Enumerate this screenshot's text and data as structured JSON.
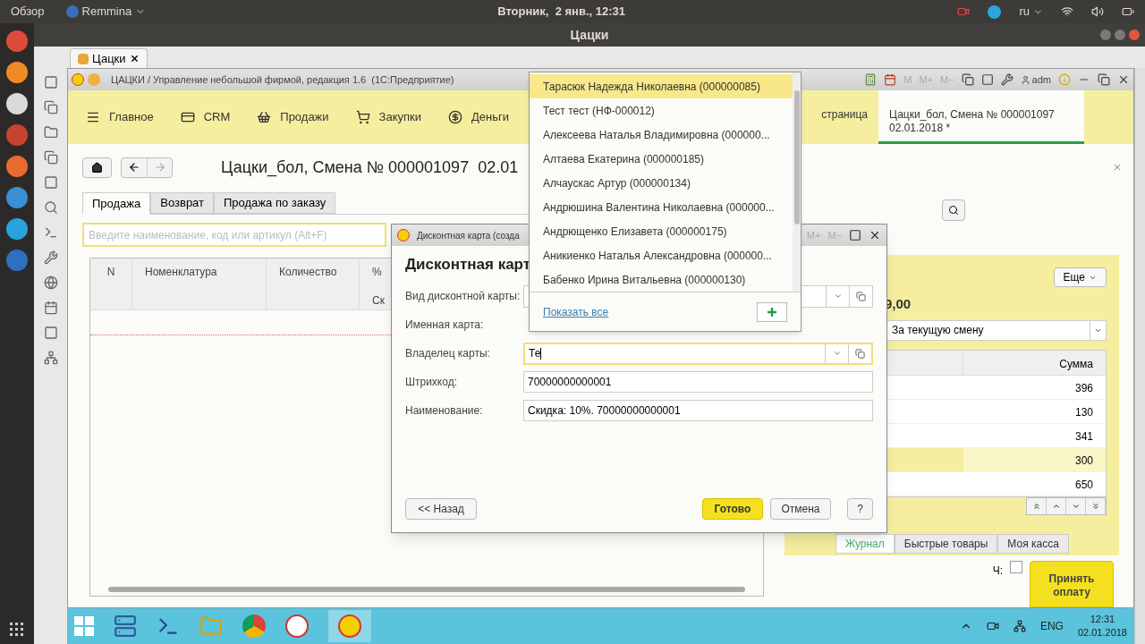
{
  "top_bar": {
    "activities": "Обзор",
    "app": "Remmina",
    "clock": "Вторник,  2 янв., 12:31",
    "keyboard": "ru"
  },
  "remmina": {
    "title": "Цацки",
    "tab": "Цацки"
  },
  "app_window": {
    "title": "ЦАЦКИ / Управление небольшой фирмой, редакция 1.6  (1С:Предприятие)",
    "memory_buttons": [
      "M",
      "M+",
      "M−"
    ],
    "user": "adm"
  },
  "sections": [
    {
      "label": "Главное"
    },
    {
      "label": "CRM"
    },
    {
      "label": "Продажи"
    },
    {
      "label": "Закупки"
    },
    {
      "label": "Деньги"
    }
  ],
  "open_tabs": [
    {
      "label": "страница",
      "selected": false
    },
    {
      "label": "Цацки_бол, Смена № 000001097\n02.01.2018 *",
      "selected": true
    }
  ],
  "form": {
    "title": "Цацки_бол, Смена № 000001097  02.01",
    "tabs": [
      {
        "label": "Продажа",
        "selected": true
      },
      {
        "label": "Возврат",
        "selected": false
      },
      {
        "label": "Продажа по заказу",
        "selected": false
      }
    ],
    "search": {
      "placeholder": "Введите наименование, код или артикул (Alt+F)"
    },
    "columns": [
      "N",
      "Номенклатура",
      "Количество",
      "%"
    ],
    "subcolumn": "Ск"
  },
  "side_panel": {
    "more": "Еще",
    "total": "9,00",
    "period": "За текущую смену",
    "sum_header": "Сумма",
    "rows": [
      {
        "sum": "396",
        "selected": false
      },
      {
        "sum": "130",
        "selected": false
      },
      {
        "sum": "341",
        "selected": false
      },
      {
        "sum": "300",
        "selected": true
      },
      {
        "sum": "650",
        "selected": false
      }
    ],
    "tabs": [
      {
        "label": "Журнал",
        "selected": true
      },
      {
        "label": "Быстрые товары",
        "selected": false
      },
      {
        "label": "Моя касса",
        "selected": false
      }
    ],
    "check_label": "Ч:",
    "checked": false,
    "pay_button": "Принять оплату"
  },
  "dialog": {
    "title": "Дисконтная карта (созда",
    "memory_buttons": [
      "M+",
      "M−"
    ],
    "heading": "Дисконтная карт",
    "fields": [
      {
        "label": "Вид дисконтной карты:",
        "kind": "select",
        "focused": false
      },
      {
        "label": "Именная карта:",
        "kind": "label"
      },
      {
        "label": "Владелец карты:",
        "kind": "select",
        "value": "Те",
        "focused": true
      },
      {
        "label": "Штрихкод:",
        "kind": "text",
        "value": "70000000000001"
      },
      {
        "label": "Наименование:",
        "kind": "text",
        "value": "Скидка: 10%. 70000000000001"
      }
    ],
    "buttons": [
      {
        "label": "<< Назад",
        "kind": "back"
      },
      {
        "label": "Готово",
        "kind": "primary"
      },
      {
        "label": "Отмена",
        "kind": "normal"
      },
      {
        "label": "?",
        "kind": "normal"
      }
    ]
  },
  "dropdown": {
    "items": [
      {
        "text": "Тарасюк Надежда Николаевна (000000085)",
        "selected": true
      },
      {
        "text": "Тест тест (НФ-000012)",
        "selected": false
      },
      {
        "text": "Алексеева Наталья Владимировна (000000...",
        "selected": false
      },
      {
        "text": "Алтаева Екатерина (000000185)",
        "selected": false
      },
      {
        "text": "Алчаускас Артур (000000134)",
        "selected": false
      },
      {
        "text": "Андрюшина Валентина Николаевна (000000...",
        "selected": false
      },
      {
        "text": "Андрющенко Елизавета (000000175)",
        "selected": false
      },
      {
        "text": "Аникиенко Наталья Александровна (000000...",
        "selected": false
      },
      {
        "text": "Бабенко Ирина Витальевна (000000130)",
        "selected": false
      }
    ],
    "show_all": "Показать все"
  },
  "taskbar": {
    "language": "ENG",
    "time": "12:31",
    "date": "02.01.2018"
  }
}
